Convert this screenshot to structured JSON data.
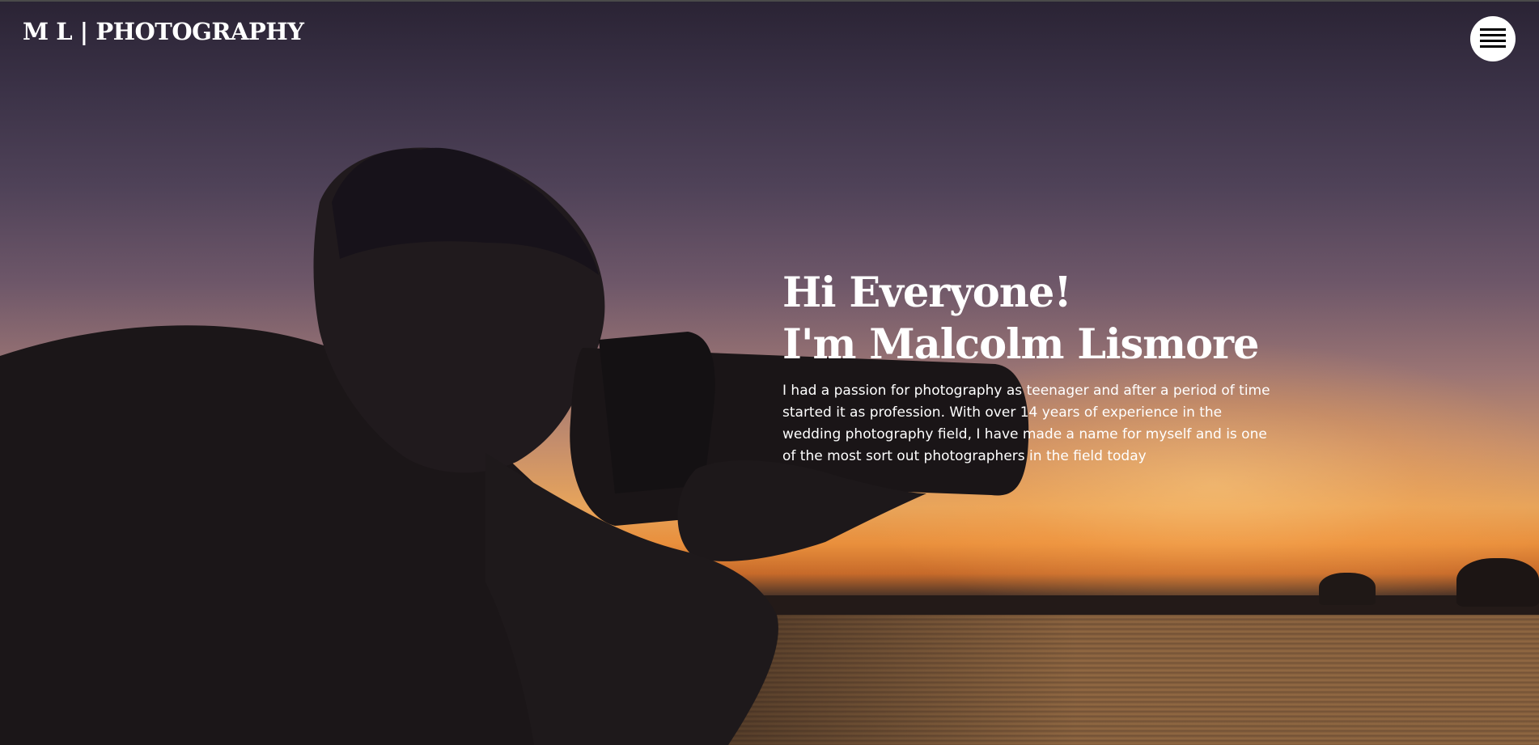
{
  "header": {
    "brand": "M L | PHOTOGRAPHY",
    "menu_icon": "hamburger-menu-icon"
  },
  "hero": {
    "greeting_line1": "Hi Everyone!",
    "greeting_line2": "I'm Malcolm Lismore",
    "bio": "I had a passion for photography as teenager and after a period of time started it as profession. With over 14 years of experience in the wedding photography field, I have made a name for myself and is one of the most sort out photographers in the field today"
  },
  "colors": {
    "text": "#ffffff",
    "menu_bg": "#ffffff",
    "sunset_orange": "#e98f3c",
    "sky_purple": "#3b3247"
  }
}
